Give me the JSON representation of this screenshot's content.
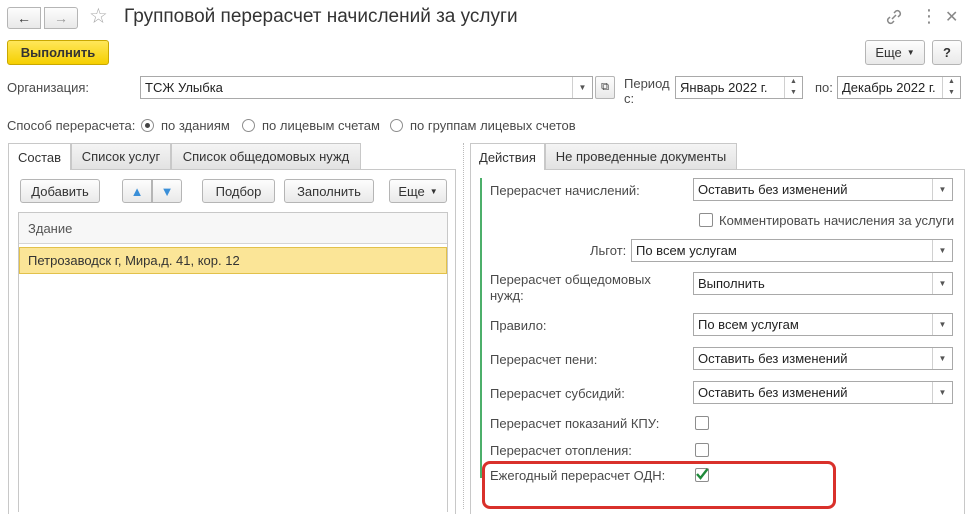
{
  "window": {
    "title": "Групповой перерасчет начислений за услуги",
    "nav_back": "←",
    "nav_forward": "→",
    "star": "☆",
    "link_icon": "🔗",
    "more_icon": "⋮",
    "close_icon": "✕"
  },
  "toolbar": {
    "execute_label": "Выполнить",
    "more_label": "Еще",
    "help_label": "?"
  },
  "header": {
    "organization_label": "Организация:",
    "organization_value": "ТСЖ Улыбка",
    "period_label": "Период с:",
    "period_from": "Январь 2022 г.",
    "period_to_label": "по:",
    "period_to": "Декабрь 2022 г."
  },
  "recalc_method": {
    "label": "Способ перерасчета:",
    "options": [
      "по зданиям",
      "по лицевым счетам",
      "по группам лицевых счетов"
    ],
    "selected_index": 0
  },
  "left_tabs": [
    "Состав",
    "Список услуг",
    "Список общедомовых нужд"
  ],
  "left_toolbar": {
    "add_label": "Добавить",
    "up_icon": "🡅",
    "down_icon": "🡇",
    "pick_label": "Подбор",
    "fill_label": "Заполнить",
    "more_label": "Еще"
  },
  "buildings_table": {
    "column_header": "Здание",
    "rows": [
      "Петрозаводск г, Мира,д. 41, кор. 12"
    ]
  },
  "right_tabs": [
    "Действия",
    "Не проведенные документы"
  ],
  "actions": {
    "recalc_charges_label": "Перерасчет начислений:",
    "recalc_charges_value": "Оставить без изменений",
    "comment_label": "Комментировать начисления за услуги",
    "benefits_label": "Льгот:",
    "benefits_value": "По всем услугам",
    "common_needs_label": "Перерасчет общедомовых нужд:",
    "common_needs_value": "Выполнить",
    "rule_label": "Правило:",
    "rule_value": "По всем услугам",
    "penalty_label": "Перерасчет пени:",
    "penalty_value": "Оставить без изменений",
    "subsidy_label": "Перерасчет субсидий:",
    "subsidy_value": "Оставить без изменений",
    "kpu_label": "Перерасчет показаний КПУ:",
    "heating_label": "Перерасчет отопления:",
    "annual_odn_label": "Ежегодный перерасчет ОДН:",
    "annual_odn_checked": true
  },
  "colors": {
    "accent_yellow": "#f5cf00",
    "selected_row": "#fbe597",
    "highlight_red": "#d9312b",
    "check_green": "#1f8a3a"
  }
}
